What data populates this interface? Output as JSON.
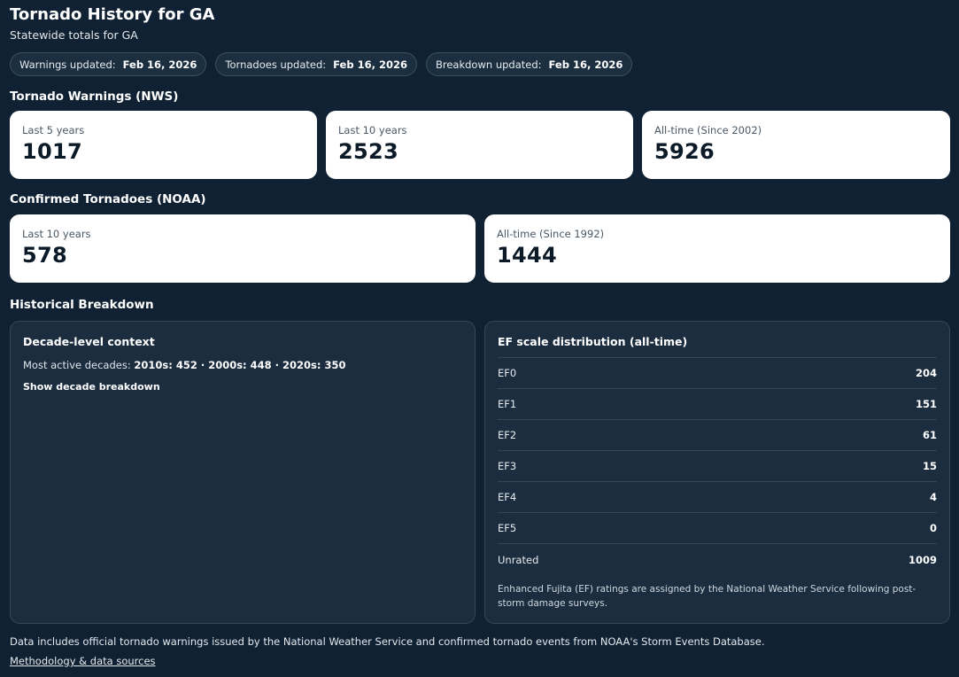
{
  "header": {
    "title": "Tornado History for GA",
    "subtitle": "Statewide totals for GA"
  },
  "chips": [
    {
      "label": "Warnings updated:",
      "value": "Feb 16, 2026"
    },
    {
      "label": "Tornadoes updated:",
      "value": "Feb 16, 2026"
    },
    {
      "label": "Breakdown updated:",
      "value": "Feb 16, 2026"
    }
  ],
  "warnings": {
    "heading": "Tornado Warnings (NWS)",
    "cards": [
      {
        "label": "Last 5 years",
        "value": "1017"
      },
      {
        "label": "Last 10 years",
        "value": "2523"
      },
      {
        "label": "All-time (Since 2002)",
        "value": "5926"
      }
    ]
  },
  "tornadoes": {
    "heading": "Confirmed Tornadoes (NOAA)",
    "cards": [
      {
        "label": "Last 10 years",
        "value": "578"
      },
      {
        "label": "All-time (Since 1992)",
        "value": "1444"
      }
    ]
  },
  "breakdown": {
    "heading": "Historical Breakdown",
    "decade": {
      "title": "Decade-level context",
      "prefix": "Most active decades:",
      "summary": "2010s: 452 · 2000s: 448 · 2020s: 350",
      "toggle_label": "Show decade breakdown"
    },
    "ef": {
      "title": "EF scale distribution (all-time)",
      "rows": [
        {
          "label": "EF0",
          "value": "204"
        },
        {
          "label": "EF1",
          "value": "151"
        },
        {
          "label": "EF2",
          "value": "61"
        },
        {
          "label": "EF3",
          "value": "15"
        },
        {
          "label": "EF4",
          "value": "4"
        },
        {
          "label": "EF5",
          "value": "0"
        },
        {
          "label": "Unrated",
          "value": "1009"
        }
      ],
      "note": "Enhanced Fujita (EF) ratings are assigned by the National Weather Service following post-storm damage surveys."
    }
  },
  "footer": {
    "note": "Data includes official tornado warnings issued by the National Weather Service and confirmed tornado events from NOAA's Storm Events Database.",
    "link_label": "Methodology & data sources"
  },
  "colors": {
    "background": "#0f2132",
    "panel": "#1c2d3f",
    "card": "#ffffff"
  }
}
